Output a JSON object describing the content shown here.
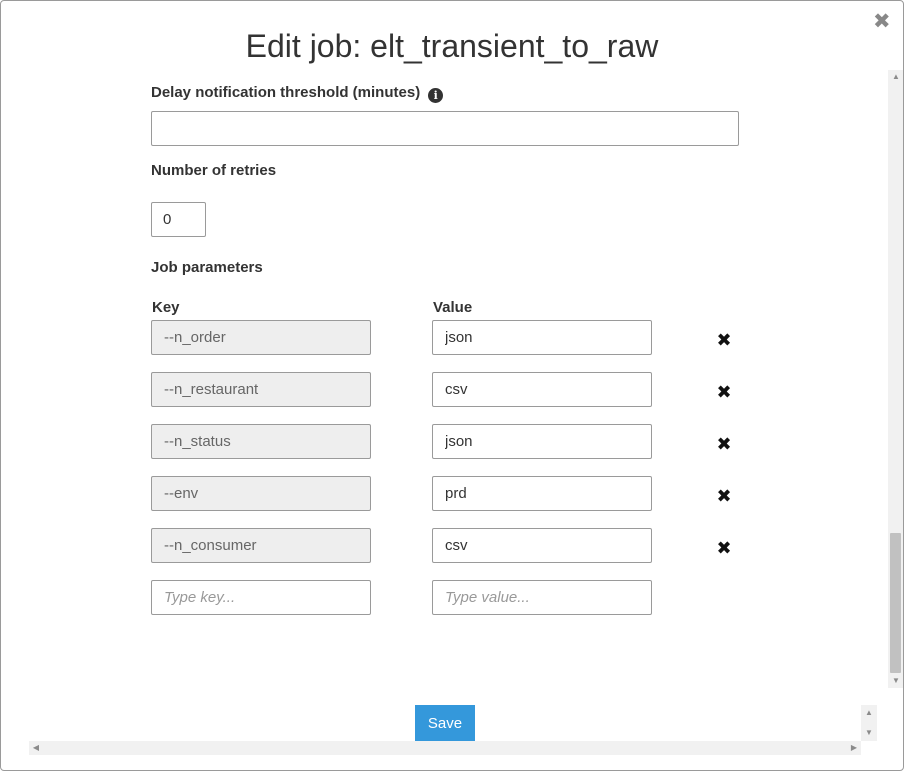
{
  "modal": {
    "title": "Edit job: elt_transient_to_raw",
    "close_glyph": "✖"
  },
  "delay_threshold": {
    "label": "Delay notification threshold (minutes)",
    "info_glyph": "i",
    "value": ""
  },
  "retries": {
    "label": "Number of retries",
    "value": "0"
  },
  "job_parameters": {
    "label": "Job parameters",
    "key_header": "Key",
    "value_header": "Value",
    "remove_glyph": "✖",
    "rows": [
      {
        "key": "--n_order",
        "value": "json"
      },
      {
        "key": "--n_restaurant",
        "value": "csv"
      },
      {
        "key": "--n_status",
        "value": "json"
      },
      {
        "key": "--env",
        "value": "prd"
      },
      {
        "key": "--n_consumer",
        "value": "csv"
      }
    ],
    "new_key_placeholder": "Type key...",
    "new_value_placeholder": "Type value..."
  },
  "footer": {
    "save_label": "Save"
  },
  "colors": {
    "primary": "#3498db",
    "readonly_bg": "#eeeeee",
    "border": "#9a9a9a"
  },
  "icons": {
    "close": "close-icon",
    "info": "info-icon",
    "remove": "remove-icon"
  }
}
